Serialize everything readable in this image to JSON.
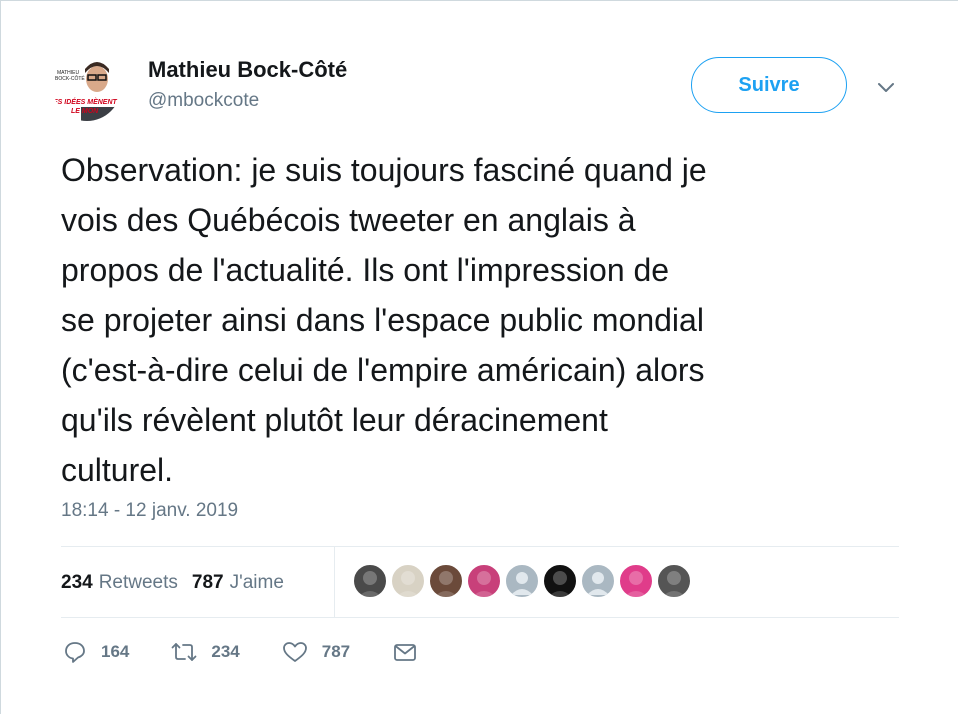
{
  "author": {
    "name": "Mathieu Bock-Côté",
    "handle": "@mbockcote",
    "avatar_caption_top": "MATHIEU BOCK-CÔTÉ",
    "avatar_caption_banner": "ES IDÉES MÈNENT LE MON"
  },
  "follow_button": {
    "label": "Suivre",
    "color": "#1da1f2"
  },
  "menu": {
    "icon": "chevron-down-icon"
  },
  "tweet": {
    "text": "Observation: je suis toujours fasciné quand je\nvois des Québécois tweeter en anglais à\npropos de l'actualité. Ils ont l'impression de\nse projeter ainsi dans l'espace public mondial\n(c'est-à-dire celui de l'empire américain) alors\nqu'ils révèlent plutôt leur déracinement\nculturel.",
    "timestamp": "18:14 - 12 janv. 2019"
  },
  "stats": {
    "retweets_count": "234",
    "retweets_label": "Retweets",
    "likes_count": "787",
    "likes_label": "J'aime"
  },
  "likers": [
    {
      "name": "liker-avatar-1",
      "color": "#4a4a4a"
    },
    {
      "name": "liker-avatar-2",
      "color": "#d8d2c4"
    },
    {
      "name": "liker-avatar-3",
      "color": "#6b4a3a"
    },
    {
      "name": "liker-avatar-4",
      "color": "#c8407a"
    },
    {
      "name": "liker-avatar-5",
      "color": "#aab8c2"
    },
    {
      "name": "liker-avatar-6",
      "color": "#111111"
    },
    {
      "name": "liker-avatar-7",
      "color": "#aab8c2"
    },
    {
      "name": "liker-avatar-8",
      "color": "#e03c8a"
    },
    {
      "name": "liker-avatar-9",
      "color": "#555555"
    }
  ],
  "actions": {
    "reply_count": "164",
    "retweet_count": "234",
    "like_count": "787"
  },
  "colors": {
    "secondary_text": "#657786",
    "primary_text": "#14171a",
    "accent": "#1da1f2"
  }
}
